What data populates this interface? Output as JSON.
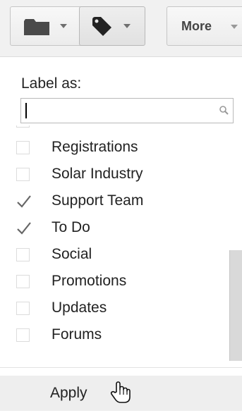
{
  "toolbar": {
    "folder_icon": "folder-icon",
    "label_icon": "label-tag-icon",
    "more_label": "More"
  },
  "menu": {
    "heading": "Label as:",
    "search": {
      "value": "",
      "placeholder": ""
    },
    "items": [
      {
        "label": "Registrations",
        "checked": false
      },
      {
        "label": "Solar Industry",
        "checked": false
      },
      {
        "label": "Support Team",
        "checked": true
      },
      {
        "label": "To Do",
        "checked": true
      },
      {
        "label": "Social",
        "checked": false
      },
      {
        "label": "Promotions",
        "checked": false
      },
      {
        "label": "Updates",
        "checked": false
      },
      {
        "label": "Forums",
        "checked": false
      }
    ],
    "apply_label": "Apply"
  },
  "colors": {
    "toolbar_bg": "#f1f1f1",
    "apply_bg": "#eeeeee",
    "check": "#666666"
  }
}
